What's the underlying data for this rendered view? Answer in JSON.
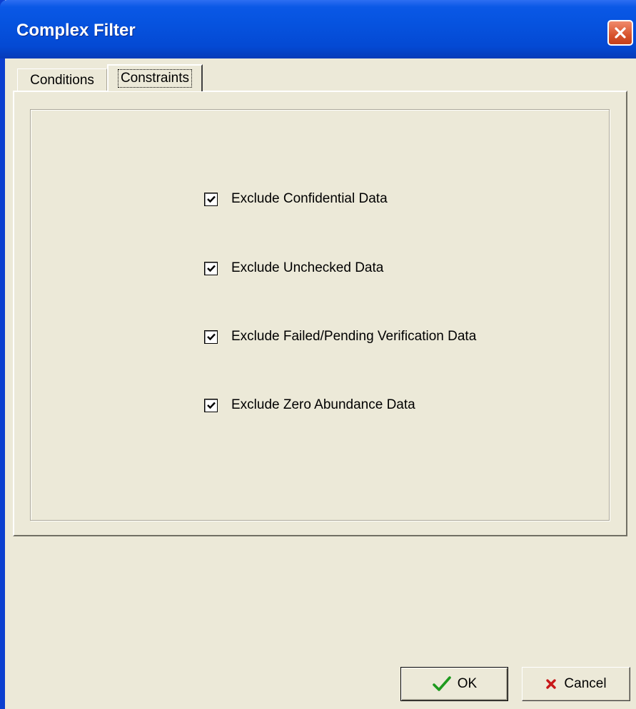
{
  "window": {
    "title": "Complex Filter"
  },
  "tabs": [
    {
      "label": "Conditions",
      "active": false
    },
    {
      "label": "Constraints",
      "active": true
    }
  ],
  "constraints": [
    {
      "label": "Exclude Confidential Data",
      "checked": true
    },
    {
      "label": "Exclude Unchecked Data",
      "checked": true
    },
    {
      "label": "Exclude Failed/Pending Verification Data",
      "checked": true
    },
    {
      "label": "Exclude Zero Abundance Data",
      "checked": true
    }
  ],
  "buttons": {
    "ok_label": "OK",
    "cancel_label": "Cancel"
  },
  "icons": {
    "close": "close-icon",
    "ok": "checkmark-icon",
    "cancel": "cross-icon"
  },
  "colors": {
    "titlebar": "#0653df",
    "dialog_bg": "#ece9d8",
    "ok_check": "#1e9a1e",
    "cancel_x": "#c8181a"
  }
}
